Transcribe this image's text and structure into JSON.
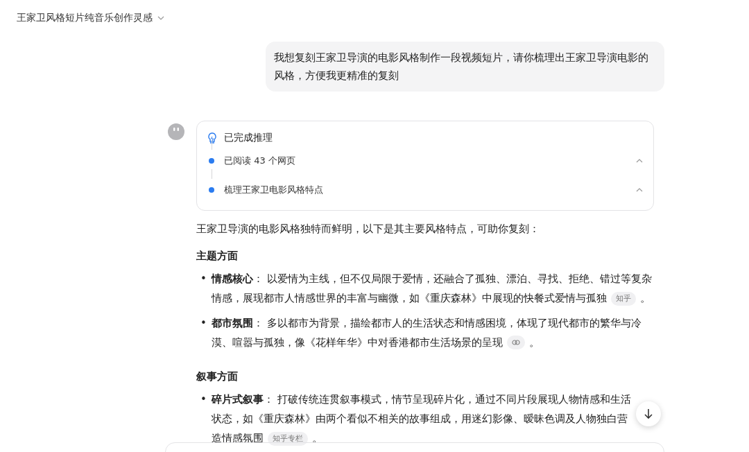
{
  "conversation": {
    "title": "王家卫风格短片纯音乐创作灵感"
  },
  "user_message": "我想复刻王家卫导演的电影风格制作一段视频短片，请你梳理出王家卫导演电影的风格，方便我更精准的复刻",
  "reasoning": {
    "title": "已完成推理",
    "steps": [
      {
        "label": "已阅读 43 个网页",
        "expanded": true
      },
      {
        "label": "梳理王家卫电影风格特点",
        "expanded": true
      }
    ]
  },
  "answer": {
    "intro": "王家卫导演的电影风格独特而鲜明，以下是其主要风格特点，可助你复刻：",
    "sections": [
      {
        "heading": "主题方面",
        "items": [
          {
            "bullet": "•",
            "text": "**情感核心**： 以爱情为主线，但不仅局限于爱情，还融合了孤独、漂泊、寻找、拒绝、错过等复杂情感，展现都市人情感世界的丰富与幽微，如《重庆森林》中展现的快餐式爱情与孤独",
            "source": {
              "kind": "text",
              "label": "知乎"
            },
            "tail": "。"
          },
          {
            "bullet": "•",
            "text": "**都市氛围**： 多以都市为背景，描绘都市人的生活状态和情感困境，体现了现代都市的繁华与冷漠、喧嚣与孤独，像《花样年华》中对香港都市生活场景的呈现",
            "source": {
              "kind": "link"
            },
            "tail": "。"
          }
        ]
      },
      {
        "heading": "叙事方面",
        "items": [
          {
            "bullet": "•",
            "text": "**碎片式叙事**： 打破传统连贯叙事模式，情节呈现碎片化，通过不同片段展现人物情感和生活状态，如《重庆森林》由两个看似不相关的故事组成，用迷幻影像、暧昧色调及人物独白营造情感氛围",
            "source": {
              "kind": "text",
              "label": "知乎专栏"
            },
            "tail": "。"
          }
        ]
      }
    ]
  }
}
